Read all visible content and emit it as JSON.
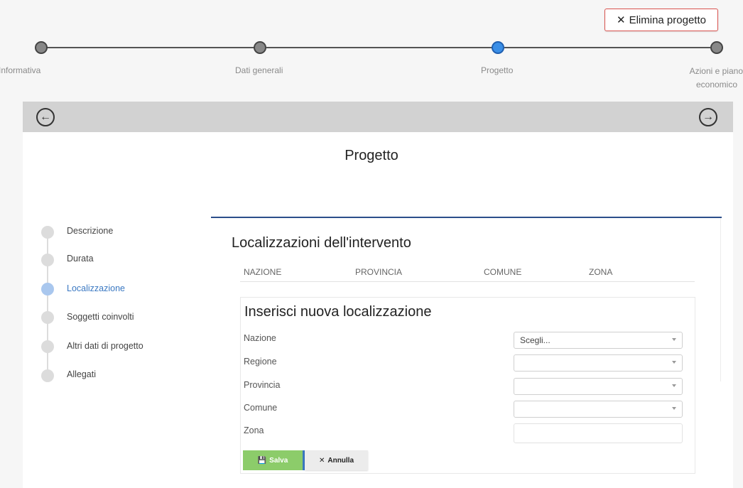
{
  "header": {
    "delete_label": "Elimina progetto"
  },
  "stepper": {
    "steps": [
      {
        "label": "Informativa"
      },
      {
        "label": "Dati generali"
      },
      {
        "label": "Progetto"
      },
      {
        "label_line1": "Azioni e piano",
        "label_line2": "economico"
      }
    ]
  },
  "page": {
    "title": "Progetto"
  },
  "sidebar": {
    "items": [
      {
        "label": "Descrizione"
      },
      {
        "label": "Durata"
      },
      {
        "label": "Localizzazione"
      },
      {
        "label": "Soggetti coinvolti"
      },
      {
        "label": "Altri dati di progetto"
      },
      {
        "label": "Allegati"
      }
    ]
  },
  "locations": {
    "title": "Localizzazioni dell'intervento",
    "columns": [
      "NAZIONE",
      "PROVINCIA",
      "COMUNE",
      "ZONA"
    ]
  },
  "form": {
    "title": "Inserisci nuova localizzazione",
    "fields": {
      "nazione": {
        "label": "Nazione",
        "value": "Scegli..."
      },
      "regione": {
        "label": "Regione",
        "value": ""
      },
      "provincia": {
        "label": "Provincia",
        "value": ""
      },
      "comune": {
        "label": "Comune",
        "value": ""
      },
      "zona": {
        "label": "Zona",
        "value": ""
      }
    },
    "save_label": "Salva",
    "cancel_label": "Annulla"
  },
  "colors": {
    "active_step": "#3a8ee6",
    "save_button": "#8ccc6a",
    "delete_border": "#d9534f",
    "accent_rule": "#2c4e8a"
  }
}
